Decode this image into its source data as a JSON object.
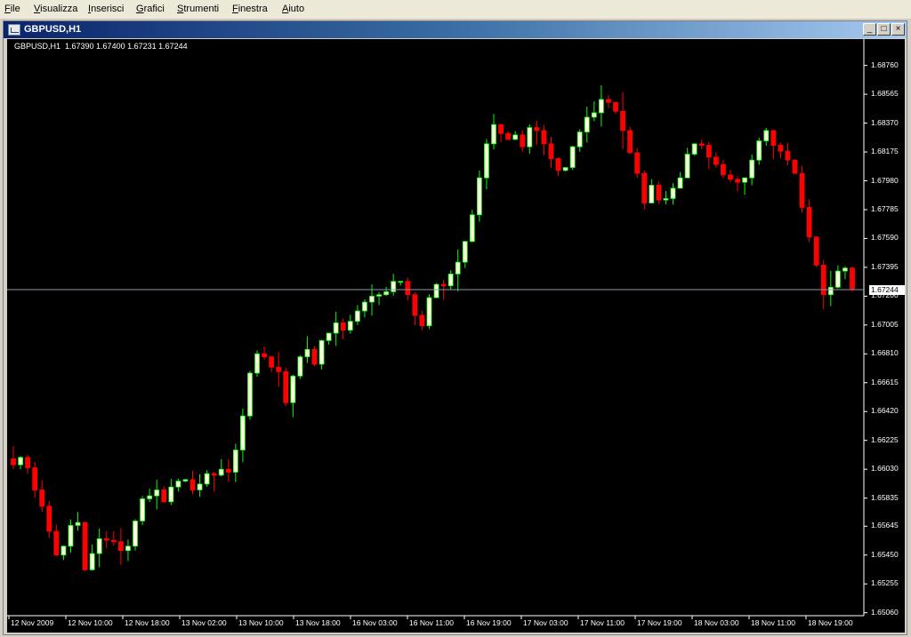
{
  "menubar": {
    "items": [
      {
        "first": "F",
        "rest": "ile"
      },
      {
        "first": "V",
        "rest": "isualizza"
      },
      {
        "first": "I",
        "rest": "nserisci"
      },
      {
        "first": "G",
        "rest": "rafici"
      },
      {
        "first": "S",
        "rest": "trumenti"
      },
      {
        "first": "F",
        "rest": "inestra"
      },
      {
        "first": "A",
        "rest": "iuto"
      }
    ]
  },
  "window": {
    "title": "GBPUSD,H1",
    "buttons": {
      "minimize": "_",
      "restore": "□",
      "close": "×"
    }
  },
  "chart": {
    "info": "GBPUSD,H1  1.67390 1.67400 1.67231 1.67244",
    "current_price_label": "1.67244",
    "colors": {
      "bull": "#00ff00",
      "bear": "#ff0000",
      "bull_body": "#ffffe0",
      "background": "#000000",
      "bid_line": "#8a9aa8",
      "axis": "#ffffff"
    }
  },
  "chart_data": {
    "type": "candlestick",
    "symbol": "GBPUSD",
    "timeframe": "H1",
    "ohlc_last": {
      "open": 1.6739,
      "high": 1.674,
      "low": 1.67231,
      "close": 1.67244
    },
    "price_ticks": [
      "1.68760",
      "1.68565",
      "1.68370",
      "1.68175",
      "1.67980",
      "1.67785",
      "1.67590",
      "1.67395",
      "1.67200",
      "1.67005",
      "1.66810",
      "1.66615",
      "1.66420",
      "1.66225",
      "1.66030",
      "1.65835",
      "1.65645",
      "1.65450",
      "1.65255",
      "1.65060"
    ],
    "time_ticks": [
      "12 Nov 2009",
      "12 Nov 10:00",
      "12 Nov 18:00",
      "13 Nov 02:00",
      "13 Nov 10:00",
      "13 Nov 18:00",
      "16 Nov 03:00",
      "16 Nov 11:00",
      "16 Nov 19:00",
      "17 Nov 03:00",
      "17 Nov 11:00",
      "17 Nov 19:00",
      "18 Nov 03:00",
      "18 Nov 11:00",
      "18 Nov 19:00"
    ],
    "ylim": [
      1.6504,
      1.6889
    ],
    "bid": 1.67244,
    "closes": [
      1.6606,
      1.6611,
      1.6604,
      1.6589,
      1.6578,
      1.6561,
      1.6545,
      1.6551,
      1.6565,
      1.6567,
      1.6535,
      1.6546,
      1.6556,
      1.6555,
      1.6554,
      1.6548,
      1.6551,
      1.6568,
      1.6583,
      1.6585,
      1.6589,
      1.6581,
      1.6591,
      1.6595,
      1.6596,
      1.6589,
      1.6593,
      1.66,
      1.6599,
      1.6603,
      1.6601,
      1.6616,
      1.6639,
      1.6668,
      1.6681,
      1.6679,
      1.6672,
      1.6669,
      1.6648,
      1.6666,
      1.6679,
      1.6684,
      1.6674,
      1.669,
      1.6695,
      1.6702,
      1.6697,
      1.6703,
      1.671,
      1.6716,
      1.672,
      1.6721,
      1.6723,
      1.673,
      1.673,
      1.6721,
      1.6707,
      1.67,
      1.6719,
      1.6728,
      1.6727,
      1.6735,
      1.6743,
      1.6757,
      1.6775,
      1.68,
      1.6823,
      1.6836,
      1.683,
      1.6826,
      1.6829,
      1.6821,
      1.6834,
      1.6832,
      1.6823,
      1.6813,
      1.6805,
      1.6807,
      1.6821,
      1.6831,
      1.6841,
      1.6844,
      1.6853,
      1.6851,
      1.6845,
      1.6832,
      1.6817,
      1.6803,
      1.6783,
      1.6795,
      1.6785,
      1.6786,
      1.6793,
      1.68,
      1.6816,
      1.6823,
      1.6822,
      1.6814,
      1.6809,
      1.6802,
      1.6799,
      1.6797,
      1.68,
      1.6812,
      1.6825,
      1.6832,
      1.6822,
      1.6818,
      1.6812,
      1.6803,
      1.678,
      1.676,
      1.6741,
      1.6721,
      1.6726,
      1.6737,
      1.6739,
      1.67244
    ],
    "xlabel": "",
    "ylabel": ""
  }
}
